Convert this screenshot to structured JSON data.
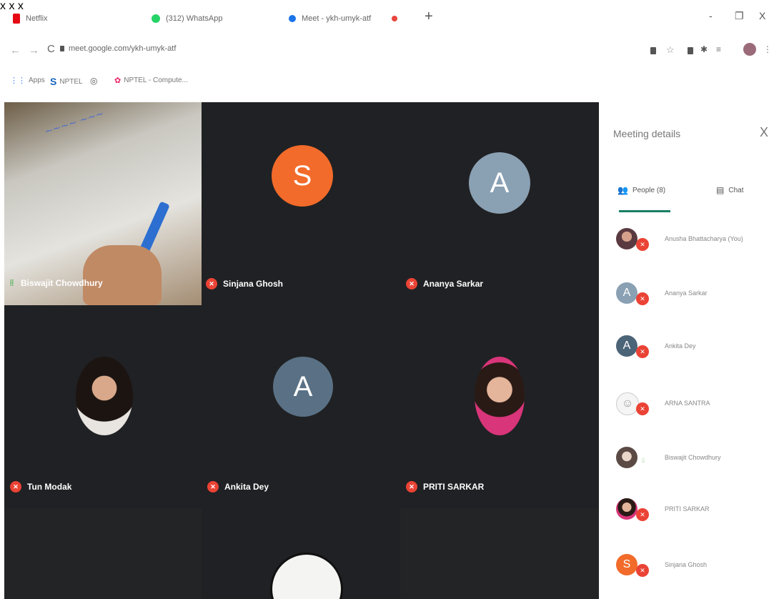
{
  "browser": {
    "tabs": [
      {
        "title": "Netflix",
        "favicon_color": "#e50914"
      },
      {
        "title": "(312) WhatsApp",
        "favicon_color": "#25d366"
      },
      {
        "title": "Meet - ykh-umyk-atf",
        "favicon_color": "#1a73e8"
      },
      {
        "title": "",
        "favicon_color": "#e8453c"
      }
    ],
    "new_tab_label": "+",
    "window_controls": {
      "minimize": "-",
      "restore": "❐",
      "close": "X"
    },
    "nav": {
      "back": "←",
      "forward": "→",
      "reload": "C"
    },
    "url": "meet.google.com/ykh-umyk-atf",
    "bookmarks": {
      "apps": "Apps",
      "nptel": "NPTEL",
      "nptel_course": "NPTEL - Compute..."
    }
  },
  "meeting": {
    "tiles": [
      {
        "name": "Biswajit Chowdhury",
        "mic": "on"
      },
      {
        "name": "Sinjana Ghosh",
        "initial": "S",
        "mic": "off",
        "color": "#f26b2a"
      },
      {
        "name": "Ananya Sarkar",
        "initial": "A",
        "mic": "off",
        "color": "#8aa0b3"
      },
      {
        "name": "Tun Modak",
        "mic": "off"
      },
      {
        "name": "Ankita Dey",
        "initial": "A",
        "mic": "off",
        "color": "#5a7185"
      },
      {
        "name": "PRITI SARKAR",
        "mic": "off"
      },
      {
        "name": "",
        "mic": "off"
      }
    ]
  },
  "panel": {
    "title": "Meeting details",
    "close_label": "X",
    "tabs": {
      "people": "People (8)",
      "chat": "Chat"
    },
    "people": [
      {
        "name": "Anusha Bhattacharya (You)",
        "mic": "off"
      },
      {
        "name": "Ananya Sarkar",
        "initial": "A",
        "mic": "off",
        "color": "#8aa0b3"
      },
      {
        "name": "Ankita Dey",
        "initial": "A",
        "mic": "off",
        "color": "#4c6478"
      },
      {
        "name": "ARNA SANTRA",
        "mic": "off"
      },
      {
        "name": "Biswajit Chowdhury",
        "mic": "on"
      },
      {
        "name": "PRITI SARKAR",
        "mic": "off"
      },
      {
        "name": "Sinjana Ghosh",
        "initial": "S",
        "mic": "off",
        "color": "#f26b2a"
      }
    ]
  },
  "colors": {
    "grid_bg": "#202124",
    "mic_off": "#ea4335",
    "accent": "#1a7f64"
  }
}
